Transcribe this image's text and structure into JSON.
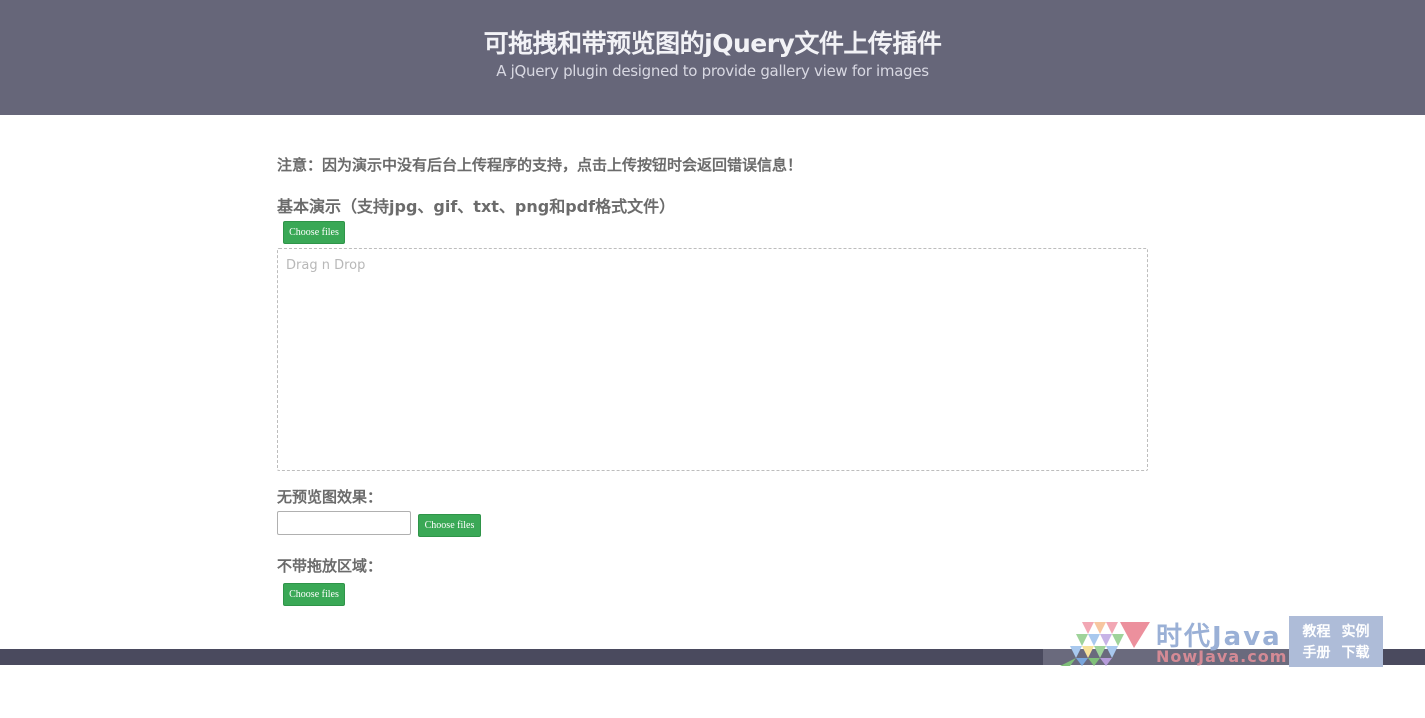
{
  "header": {
    "title": "可拖拽和带预览图的jQuery文件上传插件",
    "subtitle": "A jQuery plugin designed to provide gallery view for images"
  },
  "notice": "注意：因为演示中没有后台上传程序的支持，点击上传按钮时会返回错误信息！",
  "sections": {
    "basic": {
      "heading": "基本演示（支持jpg、gif、txt、png和pdf格式文件）",
      "button_label": "Choose files",
      "dropzone_placeholder": "Drag n Drop"
    },
    "no_preview": {
      "heading": "无预览图效果：",
      "input_value": "",
      "button_label": "Choose files"
    },
    "no_dropzone": {
      "heading": "不带拖放区域：",
      "button_label": "Choose files"
    }
  },
  "watermark": {
    "name": "时代Java",
    "domain": "NowJava.com",
    "links": [
      "教程",
      "实例",
      "手册",
      "下载"
    ]
  },
  "colors": {
    "header_bg": "#666679",
    "button_green": "#3aa856",
    "footer_bg": "#4a4a5e"
  }
}
